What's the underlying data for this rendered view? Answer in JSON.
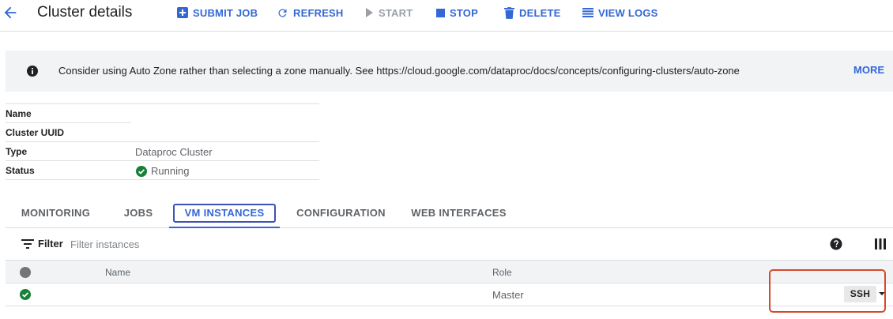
{
  "header": {
    "title": "Cluster details",
    "back_icon": "arrow-back-icon",
    "actions": [
      {
        "label": "SUBMIT JOB",
        "icon": "add-box-icon",
        "enabled": true
      },
      {
        "label": "REFRESH",
        "icon": "refresh-icon",
        "enabled": true
      },
      {
        "label": "START",
        "icon": "play-icon",
        "enabled": false
      },
      {
        "label": "STOP",
        "icon": "stop-icon",
        "enabled": true
      },
      {
        "label": "DELETE",
        "icon": "trash-icon",
        "enabled": true
      },
      {
        "label": "VIEW LOGS",
        "icon": "list-icon",
        "enabled": true
      }
    ]
  },
  "banner": {
    "icon": "info-icon",
    "message": "Consider using Auto Zone rather than selecting a zone manually. See https://cloud.google.com/dataproc/docs/concepts/configuring-clusters/auto-zone",
    "more_label": "MORE"
  },
  "details": [
    {
      "label": "Name",
      "value": ""
    },
    {
      "label": "Cluster UUID",
      "value": ""
    },
    {
      "label": "Type",
      "value": "Dataproc Cluster"
    },
    {
      "label": "Status",
      "value": "Running",
      "status_icon": "check-circle-icon"
    }
  ],
  "tabs": [
    {
      "label": "MONITORING",
      "active": false
    },
    {
      "label": "JOBS",
      "active": false
    },
    {
      "label": "VM INSTANCES",
      "active": true
    },
    {
      "label": "CONFIGURATION",
      "active": false
    },
    {
      "label": "WEB INTERFACES",
      "active": false
    }
  ],
  "filter": {
    "label": "Filter",
    "placeholder": "Filter instances",
    "icon": "filter-icon"
  },
  "toolbar_icons": [
    "help-icon",
    "columns-icon"
  ],
  "instances_table": {
    "columns": [
      "",
      "Name",
      "Role"
    ],
    "rows": [
      {
        "status": "running",
        "name": "",
        "role": "Master",
        "action": "SSH"
      }
    ]
  },
  "colors": {
    "accent": "#3367d6",
    "success": "#188038",
    "annotation": "#d64a2b"
  }
}
